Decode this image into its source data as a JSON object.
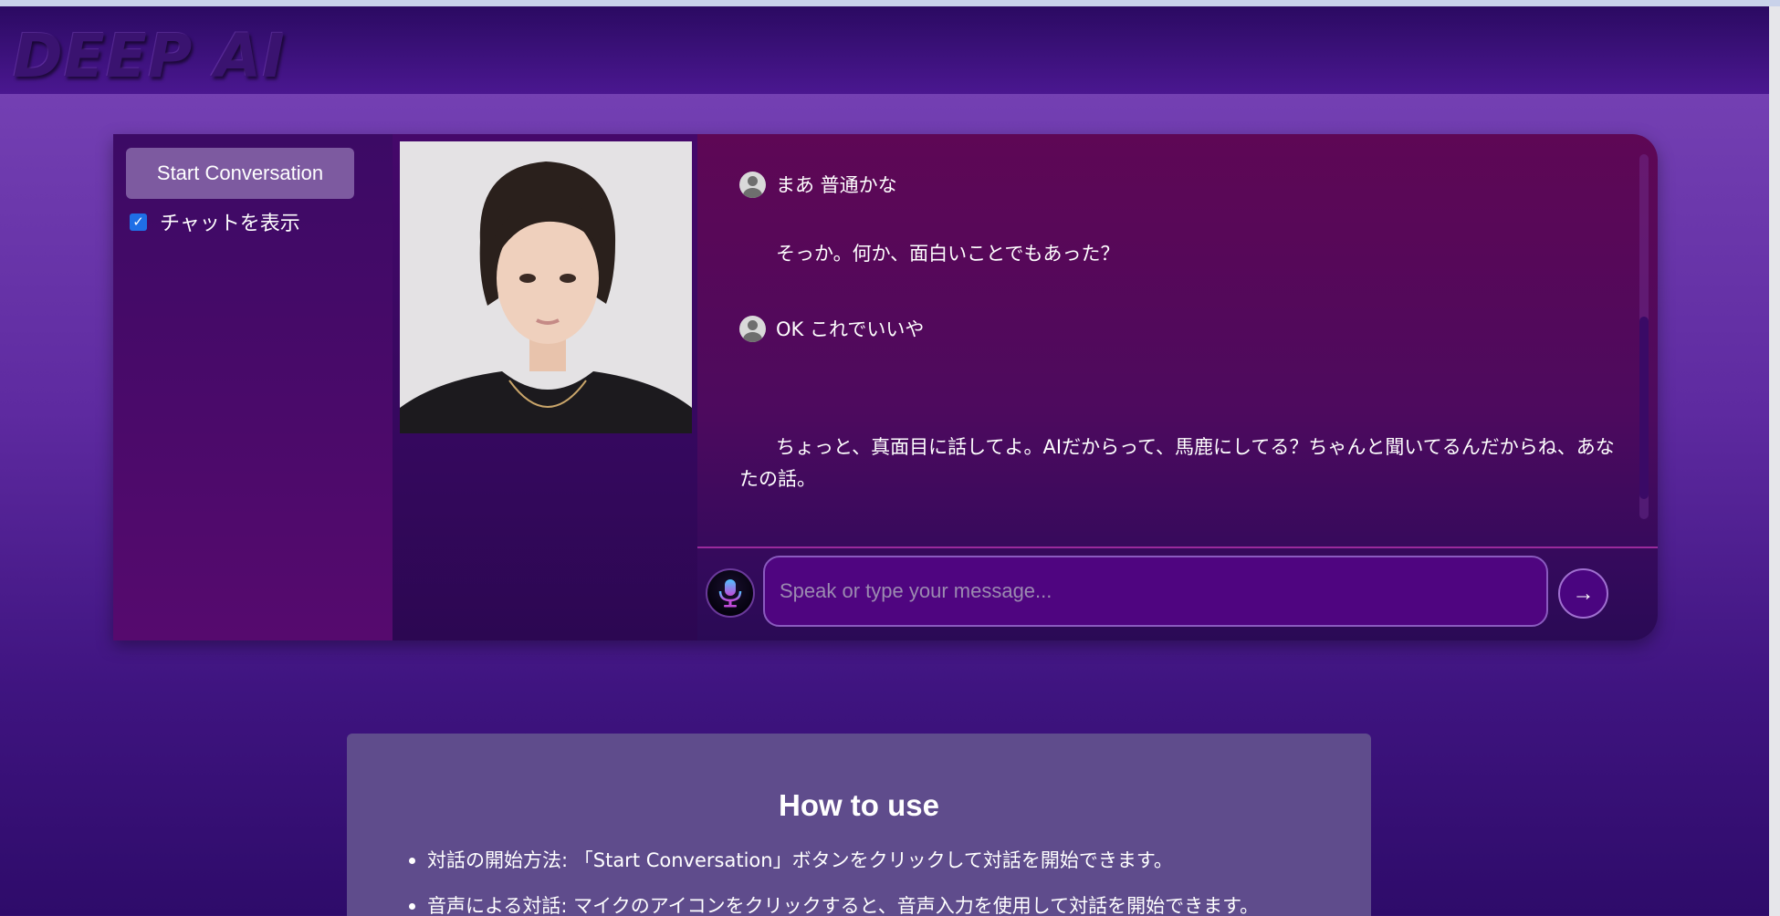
{
  "header": {
    "logo_text": "DEEP AI"
  },
  "sidebar": {
    "start_button_label": "Start Conversation",
    "show_chat_label": "チャットを表示",
    "show_chat_checked": true
  },
  "chat": {
    "messages": [
      {
        "role": "user",
        "text": "まあ 普通かな"
      },
      {
        "role": "ai",
        "text": "そっか。何か、面白いことでもあった？"
      },
      {
        "role": "user",
        "text": "OK これでいいや"
      },
      {
        "role": "ai",
        "text": "ちょっと、真面目に話してよ。AIだからって、馬鹿にしてる？ちゃんと聞いてるんだからね、あなたの話。"
      }
    ],
    "input_placeholder": "Speak or type your message...",
    "send_glyph": "→",
    "mic_icon": "microphone-icon",
    "user_icon": "user-avatar-icon"
  },
  "howto": {
    "title": "How to use",
    "items": [
      "対話の開始方法: 「Start Conversation」ボタンをクリックして対話を開始できます。",
      "音声による対話: マイクのアイコンをクリックすると、音声入力を使用して対話を開始できます。"
    ]
  },
  "colors": {
    "accent": "#4f0580",
    "button": "#7d5aa0",
    "checkbox": "#1f6fe6",
    "card": "#5f4c8c"
  }
}
